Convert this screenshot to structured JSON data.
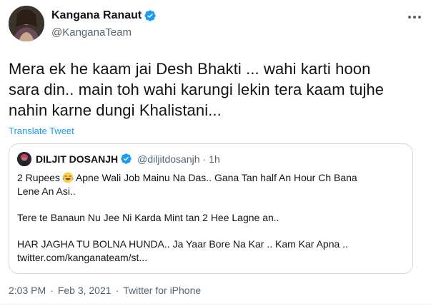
{
  "author": {
    "display_name": "Kangana Ranaut",
    "handle": "@KanganaTeam",
    "verified_icon": "verified-badge-icon"
  },
  "tweet": {
    "lines": [
      "Mera ek he kaam jai Desh Bhakti ... wahi karti hoon",
      "sara din.. main toh wahi karungi lekin tera kaam tujhe",
      "nahin karne dungi Khalistani..."
    ],
    "translate_label": "Translate Tweet"
  },
  "quoted": {
    "display_name": "DILJIT DOSANJH",
    "handle": "@diljitdosanjh",
    "separator": "·",
    "time": "1h",
    "line1_a": "2 Rupees",
    "line1_b": "Apne Wali Job Mainu Na Das.. Gana Tan half An Hour Ch Bana",
    "line2": "Lene An Asi..",
    "line3": "Tere te Banaun Nu Jee Ni Karda Mint tan 2 Hee Lagne an..",
    "line4": "HAR JAGHA TU BOLNA HUNDA.. Ja Yaar Bore Na Kar .. Kam Kar Apna ..",
    "line5": "twitter.com/kanganateam/st..."
  },
  "meta": {
    "time": "2:03 PM",
    "sep1": "·",
    "date": "Feb 3, 2021",
    "sep2": "·",
    "source": "Twitter for iPhone"
  },
  "colors": {
    "accent": "#1d9bf0",
    "secondary_text": "#536471",
    "border": "#cfd9de"
  }
}
